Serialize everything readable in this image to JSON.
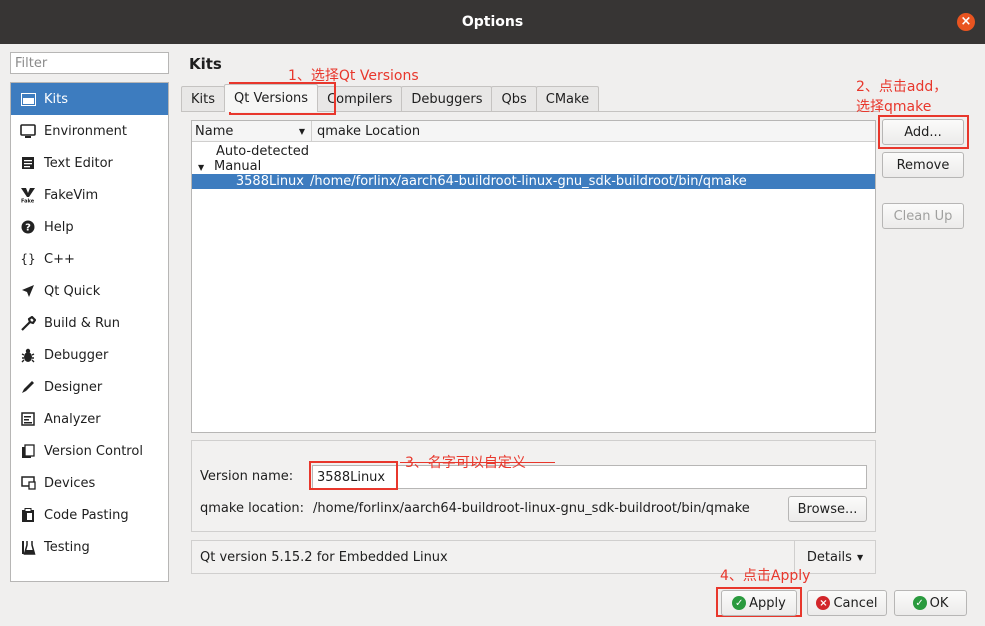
{
  "window": {
    "title": "Options",
    "close_glyph": "×"
  },
  "filter": {
    "placeholder": "Filter"
  },
  "sidebar": {
    "items": [
      {
        "label": "Kits",
        "icon": "kits-icon"
      },
      {
        "label": "Environment",
        "icon": "environment-icon"
      },
      {
        "label": "Text Editor",
        "icon": "text-editor-icon"
      },
      {
        "label": "FakeVim",
        "icon": "fakevim-icon"
      },
      {
        "label": "Help",
        "icon": "help-icon"
      },
      {
        "label": "C++",
        "icon": "cpp-icon"
      },
      {
        "label": "Qt Quick",
        "icon": "qt-quick-icon"
      },
      {
        "label": "Build & Run",
        "icon": "build-run-icon"
      },
      {
        "label": "Debugger",
        "icon": "debugger-icon"
      },
      {
        "label": "Designer",
        "icon": "designer-icon"
      },
      {
        "label": "Analyzer",
        "icon": "analyzer-icon"
      },
      {
        "label": "Version Control",
        "icon": "version-control-icon"
      },
      {
        "label": "Devices",
        "icon": "devices-icon"
      },
      {
        "label": "Code Pasting",
        "icon": "code-pasting-icon"
      },
      {
        "label": "Testing",
        "icon": "testing-icon"
      }
    ],
    "active_index": 0
  },
  "page": {
    "title": "Kits"
  },
  "tabs": [
    {
      "label": "Kits"
    },
    {
      "label": "Qt Versions"
    },
    {
      "label": "Compilers"
    },
    {
      "label": "Debuggers"
    },
    {
      "label": "Qbs"
    },
    {
      "label": "CMake"
    }
  ],
  "active_tab": "Qt Versions",
  "list": {
    "columns": [
      "Name",
      "qmake Location"
    ],
    "rows": [
      {
        "name": "Auto-detected",
        "location": "",
        "type": "group"
      },
      {
        "name": "Manual",
        "location": "",
        "type": "group-expanded"
      },
      {
        "name": "3588Linux",
        "location": "/home/forlinx/aarch64-buildroot-linux-gnu_sdk-buildroot/bin/qmake",
        "type": "item"
      }
    ]
  },
  "buttons": {
    "add": "Add...",
    "remove": "Remove",
    "cleanup": "Clean Up",
    "browse": "Browse...",
    "details": "Details",
    "apply": "Apply",
    "cancel": "Cancel",
    "ok": "OK"
  },
  "details": {
    "version_name_label": "Version name:",
    "version_name_value": "3588Linux",
    "qmake_location_label": "qmake location:",
    "qmake_location_value": "/home/forlinx/aarch64-buildroot-linux-gnu_sdk-buildroot/bin/qmake"
  },
  "summary": {
    "text": "Qt version 5.15.2 for Embedded Linux"
  },
  "annotations": {
    "step1": "1、选择Qt Versions",
    "step2_line1": "2、点击add，",
    "step2_line2": "选择qmake",
    "step3": "3、名字可以自定义",
    "step4": "4、点击Apply"
  },
  "colors": {
    "accent": "#3d7cbf",
    "annotation": "#e8372c",
    "close_button": "#e95420",
    "titlebar": "#373534",
    "apply_icon": "#2a9a3e",
    "cancel_icon": "#d2262a"
  }
}
